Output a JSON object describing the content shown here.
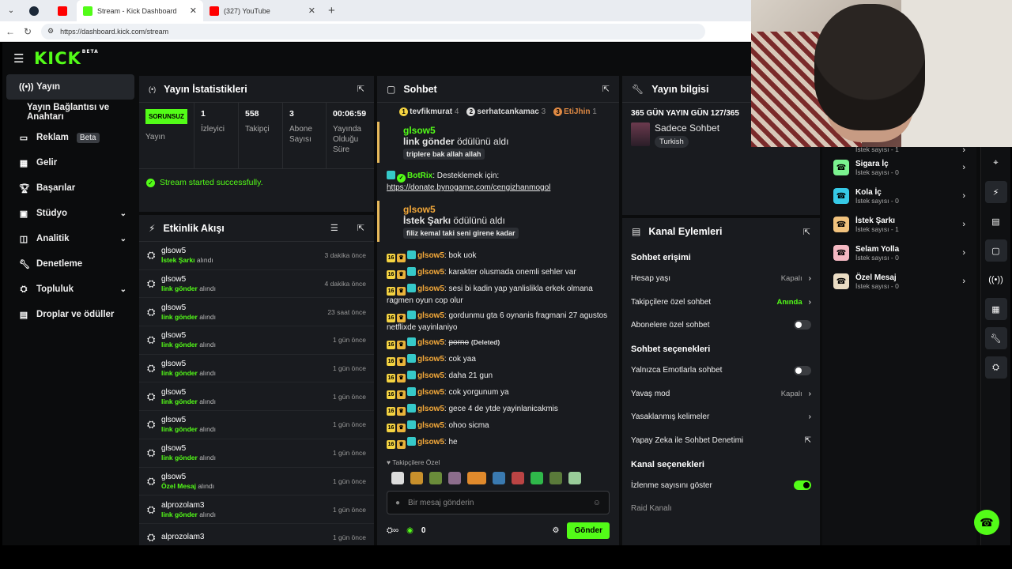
{
  "browser": {
    "tabs": [
      {
        "label": "Stream - Kick Dashboard"
      },
      {
        "label": "(327) YouTube"
      }
    ],
    "url": "https://dashboard.kick.com/stream"
  },
  "app": {
    "logo": "KICK",
    "logo_badge": "BETA"
  },
  "sidebar": {
    "items": [
      {
        "label": "Yayın",
        "icon": "broadcast-icon"
      },
      {
        "label": "Yayın Bağlantısı ve Anahtarı"
      },
      {
        "label": "Reklam",
        "badge": "Beta",
        "icon": "ad-icon"
      },
      {
        "label": "Gelir",
        "icon": "chart-icon"
      },
      {
        "label": "Başarılar",
        "icon": "trophy-icon"
      },
      {
        "label": "Stüdyo",
        "icon": "studio-icon"
      },
      {
        "label": "Analitik",
        "icon": "analytics-icon"
      },
      {
        "label": "Denetleme",
        "icon": "wrench-icon"
      },
      {
        "label": "Topluluk",
        "icon": "community-icon"
      },
      {
        "label": "Droplar ve ödüller",
        "icon": "gift-icon"
      }
    ]
  },
  "stats": {
    "title": "Yayın İstatistikleri",
    "live": "SORUNSUZ",
    "live_label": "Yayın",
    "viewers": "1",
    "viewers_label": "İzleyici",
    "followers": "558",
    "followers_label": "Takipçi",
    "subs": "3",
    "subs_label": "Abone Sayısı",
    "duration": "00:06:59",
    "duration_label": "Yayında Olduğu Süre",
    "status": "Stream started successfully."
  },
  "activity": {
    "title": "Etkinlik Akışı",
    "events": [
      {
        "user": "glsow5",
        "item": "İstek Şarkı",
        "suffix": "alındı",
        "time": "3 dakika önce"
      },
      {
        "user": "glsow5",
        "item": "link gönder",
        "suffix": "alındı",
        "time": "4 dakika önce"
      },
      {
        "user": "glsow5",
        "item": "link gönder",
        "suffix": "alındı",
        "time": "23 saat önce"
      },
      {
        "user": "glsow5",
        "item": "link gönder",
        "suffix": "alındı",
        "time": "1 gün önce"
      },
      {
        "user": "glsow5",
        "item": "link gönder",
        "suffix": "alındı",
        "time": "1 gün önce"
      },
      {
        "user": "glsow5",
        "item": "link gönder",
        "suffix": "alındı",
        "time": "1 gün önce"
      },
      {
        "user": "glsow5",
        "item": "link gönder",
        "suffix": "alındı",
        "time": "1 gün önce"
      },
      {
        "user": "glsow5",
        "item": "link gönder",
        "suffix": "alındı",
        "time": "1 gün önce"
      },
      {
        "user": "glsow5",
        "item": "Özel Mesaj",
        "suffix": "alındı",
        "time": "1 gün önce"
      },
      {
        "user": "alprozolam3",
        "item": "link gönder",
        "suffix": "alındı",
        "time": "1 gün önce"
      },
      {
        "user": "alprozolam3",
        "item": "",
        "suffix": "",
        "time": "1 gün önce"
      }
    ]
  },
  "chat": {
    "title": "Sohbet",
    "gifters": [
      {
        "name": "tevfikmurat",
        "count": "4",
        "rank": "1"
      },
      {
        "name": "serhatcankamac",
        "count": "3",
        "rank": "2"
      },
      {
        "name": "EtiJhin",
        "count": "1",
        "rank": "3"
      }
    ],
    "redeem1": {
      "user": "glsow5",
      "reward": "link gönder",
      "suffix": "ödülünü aldı",
      "note": "triplere bak allah allah"
    },
    "botrix": {
      "user": "BotRix",
      "text": "Desteklemek için:",
      "link": "https://donate.bynogame.com/cengizhanmogol"
    },
    "redeem2": {
      "user": "glsow5",
      "reward": "İstek Şarkı",
      "suffix": "ödülünü aldı",
      "note": "filiz kemal taki seni girene kadar"
    },
    "badge_num": "16",
    "messages": [
      {
        "user": "glsow5",
        "text": "bok uok"
      },
      {
        "user": "glsow5",
        "text": "karakter olusmada onemli sehler var"
      },
      {
        "user": "glsow5",
        "text": "sesi bi kadin yap yanlislikla erkek olmana ragmen oyun cop olur"
      },
      {
        "user": "glsow5",
        "text": "gordunmu gta 6 oynanis fragmani 27 agustos netflixde yayinlaniyo"
      },
      {
        "user": "glsow5",
        "text": "porno",
        "deleted": "(Deleted)"
      },
      {
        "user": "glsow5",
        "text": "cok yaa"
      },
      {
        "user": "glsow5",
        "text": "daha 21 gun"
      },
      {
        "user": "glsow5",
        "text": "cok yorgunum ya"
      },
      {
        "user": "glsow5",
        "text": "gece 4 de ytde yayinlanicakmis"
      },
      {
        "user": "glsow5",
        "text": "ohoo sicma"
      },
      {
        "user": "glsow5",
        "text": "he"
      }
    ],
    "followers_only": "Takipçilere Özel",
    "placeholder": "Bir mesaj gönderin",
    "points": "0",
    "send": "Gönder"
  },
  "streaminfo": {
    "title": "Yayın bilgisi",
    "stream_title": "365 GÜN YAYIN GÜN 127/365",
    "category": "Sadece Sohbet",
    "lang": "Turkish"
  },
  "channel": {
    "title": "Kanal Eylemleri",
    "chat_access": "Sohbet erişimi",
    "account_age": "Hesap yaşı",
    "account_age_val": "Kapalı",
    "followers_chat": "Takipçilere özel sohbet",
    "followers_chat_val": "Anında",
    "subs_chat": "Abonelere özel sohbet",
    "chat_options": "Sohbet seçenekleri",
    "emote_only": "Yalnızca Emotlarla sohbet",
    "slow": "Yavaş mod",
    "slow_val": "Kapalı",
    "banned": "Yasaklanmış kelimeler",
    "ai": "Yapay Zeka ile Sohbet Denetimi",
    "channel_options": "Kanal seçenekleri",
    "show_views": "İzlenme sayısını göster",
    "raid": "Raid Kanalı"
  },
  "rewards": [
    {
      "name": "Sigara İç",
      "count": "İstek sayısı - 0",
      "color": "#7bf28f"
    },
    {
      "name": "Kola İç",
      "count": "İstek sayısı - 0",
      "color": "#36c9e6"
    },
    {
      "name": "İstek Şarkı",
      "count": "İstek sayısı - 1",
      "color": "#f1c27d"
    },
    {
      "name": "Selam Yolla",
      "count": "İstek sayısı - 0",
      "color": "#f4b8c2"
    },
    {
      "name": "Özel Mesaj",
      "count": "İstek sayısı - 0",
      "color": "#eadcc3"
    }
  ],
  "rewards_top": "İstek sayısı - 1",
  "colors": {
    "accent": "#53fc18",
    "panel": "#191b1f"
  }
}
